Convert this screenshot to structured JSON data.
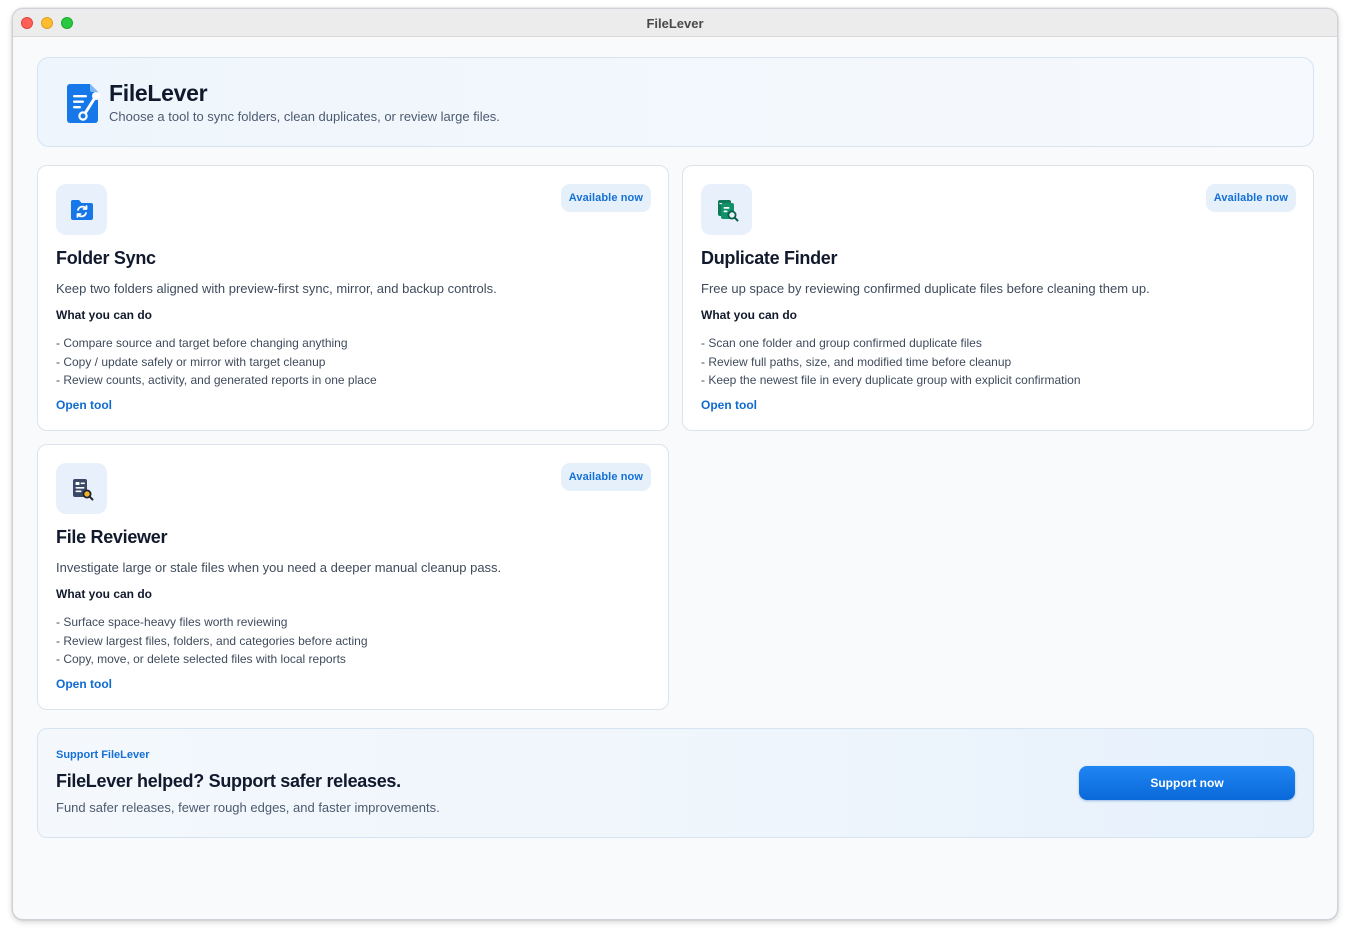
{
  "window": {
    "title": "FileLever"
  },
  "hero": {
    "title": "FileLever",
    "subtitle": "Choose a tool to sync folders, clean duplicates, or review large files."
  },
  "tools": [
    {
      "icon": "folder-sync-icon",
      "badge": "Available now",
      "title": "Folder Sync",
      "description": "Keep two folders aligned with preview-first sync, mirror, and backup controls.",
      "section_heading": "What you can do",
      "features": [
        "- Compare source and target before changing anything",
        "- Copy / update safely or mirror with target cleanup",
        "- Review counts, activity, and generated reports in one place"
      ],
      "link": "Open tool"
    },
    {
      "icon": "duplicate-search-icon",
      "badge": "Available now",
      "title": "Duplicate Finder",
      "description": "Free up space by reviewing confirmed duplicate files before cleaning them up.",
      "section_heading": "What you can do",
      "features": [
        "- Scan one folder and group confirmed duplicate files",
        "- Review full paths, size, and modified time before cleanup",
        "- Keep the newest file in every duplicate group with explicit confirmation"
      ],
      "link": "Open tool"
    },
    {
      "icon": "file-review-icon",
      "badge": "Available now",
      "title": "File Reviewer",
      "description": "Investigate large or stale files when you need a deeper manual cleanup pass.",
      "section_heading": "What you can do",
      "features": [
        "- Surface space-heavy files worth reviewing",
        "- Review largest files, folders, and categories before acting",
        "- Copy, move, or delete selected files with local reports"
      ],
      "link": "Open tool"
    }
  ],
  "support": {
    "eyebrow": "Support FileLever",
    "title": "FileLever helped? Support safer releases.",
    "subtitle": "Fund safer releases, fewer rough edges, and faster improvements.",
    "button": "Support now"
  },
  "colors": {
    "accent": "#1470d6",
    "link": "#0f6bd0",
    "duplicate_icon": "#0f7a5a",
    "reviewer_icon": "#3a4a66"
  }
}
